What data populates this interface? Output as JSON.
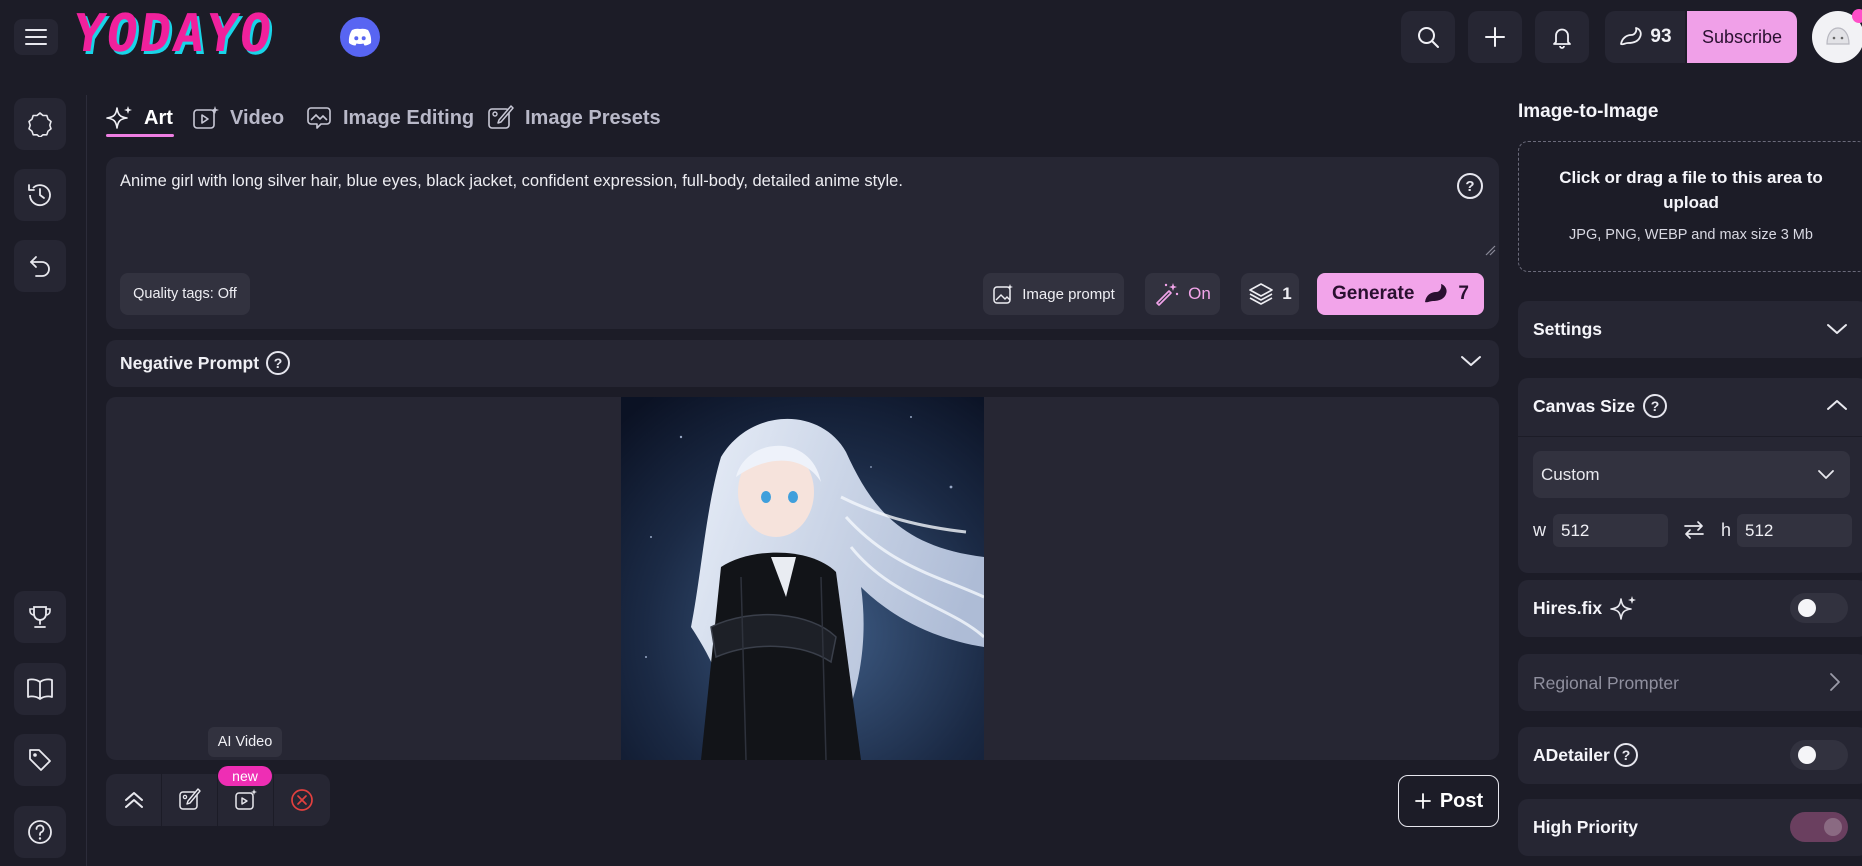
{
  "header": {
    "logo_text": "YODAYO",
    "credits": "93",
    "subscribe_label": "Subscribe"
  },
  "tabs": [
    {
      "label": "Art",
      "active": true
    },
    {
      "label": "Video",
      "active": false
    },
    {
      "label": "Image Editing",
      "active": false
    },
    {
      "label": "Image Presets",
      "active": false
    }
  ],
  "prompt": {
    "text": "Anime girl with long silver hair, blue eyes, black jacket, confident expression, full-body, detailed anime style.",
    "quality_tags": "Quality tags: Off",
    "image_prompt_label": "Image prompt",
    "magic_state": "On",
    "batch_count": "1",
    "generate_label": "Generate",
    "generate_cost": "7"
  },
  "negative_prompt": {
    "label": "Negative Prompt"
  },
  "bottom_toolbar": {
    "tooltip": "AI Video",
    "new_badge": "new",
    "post_label": "Post"
  },
  "right_panel": {
    "img2img_title": "Image-to-Image",
    "upload_main": "Click or drag a file to this area to upload",
    "upload_sub": "JPG, PNG, WEBP and max size 3 Mb",
    "settings_label": "Settings",
    "canvas_label": "Canvas Size",
    "canvas_preset": "Custom",
    "width_label": "w",
    "width_value": "512",
    "height_label": "h",
    "height_value": "512",
    "hires_label": "Hires.fix",
    "hires_on": false,
    "regional_label": "Regional Prompter",
    "adetailer_label": "ADetailer",
    "adetailer_on": false,
    "priority_label": "High Priority",
    "priority_on": true
  },
  "colors": {
    "background": "#1c1c27",
    "panel": "#262633",
    "accent_pink": "#f2a4ea",
    "badge_pink": "#ee2eb4",
    "discord": "#5865f2"
  }
}
